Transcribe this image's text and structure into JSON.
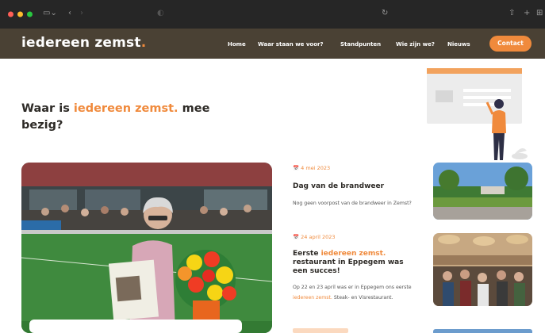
{
  "browser": {
    "address": ""
  },
  "header": {
    "logo_text": "iedereen zemst",
    "logo_dot": ".",
    "nav": [
      {
        "label": "Home"
      },
      {
        "label": "Waar staan we voor?"
      },
      {
        "label": "Standpunten"
      },
      {
        "label": "Wie zijn we?"
      },
      {
        "label": "Nieuws"
      }
    ],
    "contact_label": "Contact"
  },
  "hero": {
    "title_part1": "Waar is ",
    "title_accent": "iedereen zemst.",
    "title_part2": " mee bezig?"
  },
  "posts": [
    {
      "date": "4 mei 2023",
      "title": "Dag van de brandweer",
      "excerpt": "Nog geen voorpost van de brandweer in Zemst?"
    },
    {
      "date": "24 april 2023",
      "title_part1": "Eerste ",
      "title_accent": "iedereen zemst.",
      "title_part2": " restaurant in Eppegem was een succes!",
      "excerpt_part1": "Op 22 en 23 april was er in Eppegem ons eerste ",
      "excerpt_accent": "iedereen zemst.",
      "excerpt_part2": " Steak- en Visrestaurant."
    }
  ],
  "colors": {
    "accent": "#f08a3c",
    "header": "#4a4134",
    "text": "#2d2a26"
  }
}
